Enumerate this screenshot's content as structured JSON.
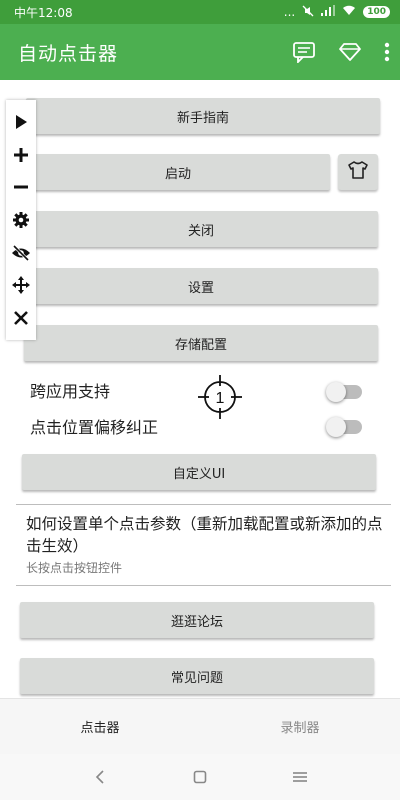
{
  "status_bar": {
    "time": "中午12:08",
    "signal_dots": "...",
    "battery": "100"
  },
  "app_bar": {
    "title": "自动点击器",
    "actions": [
      {
        "icon": "chat-icon"
      },
      {
        "icon": "diamond-icon"
      },
      {
        "icon": "more-vert-icon"
      }
    ]
  },
  "buttons": {
    "guide": "新手指南",
    "start": "启动",
    "close": "关闭",
    "settings": "设置",
    "save_config": "存储配置",
    "custom_ui": "自定义UI",
    "forum": "逛逛论坛",
    "faq": "常见问题"
  },
  "toggles": {
    "cross_app": {
      "label": "跨应用支持",
      "on": false
    },
    "offset_fix": {
      "label": "点击位置偏移纠正",
      "on": false
    }
  },
  "target_marker": {
    "number": "1"
  },
  "help": {
    "title": "如何设置单个点击参数（重新加载配置或新添加的点击生效）",
    "subtitle": "长按点击按钮控件"
  },
  "floating_toolbar": [
    {
      "icon": "play-icon"
    },
    {
      "icon": "plus-icon"
    },
    {
      "icon": "minus-icon"
    },
    {
      "icon": "gear-icon"
    },
    {
      "icon": "eye-off-icon"
    },
    {
      "icon": "move-icon"
    },
    {
      "icon": "close-icon"
    }
  ],
  "bottom_nav": {
    "tabs": [
      {
        "label": "点击器",
        "active": true
      },
      {
        "label": "录制器",
        "active": false
      }
    ]
  },
  "colors": {
    "status_bar": "#3f9e3b",
    "app_bar": "#4caf50",
    "button_bg": "#d9dbd9"
  }
}
